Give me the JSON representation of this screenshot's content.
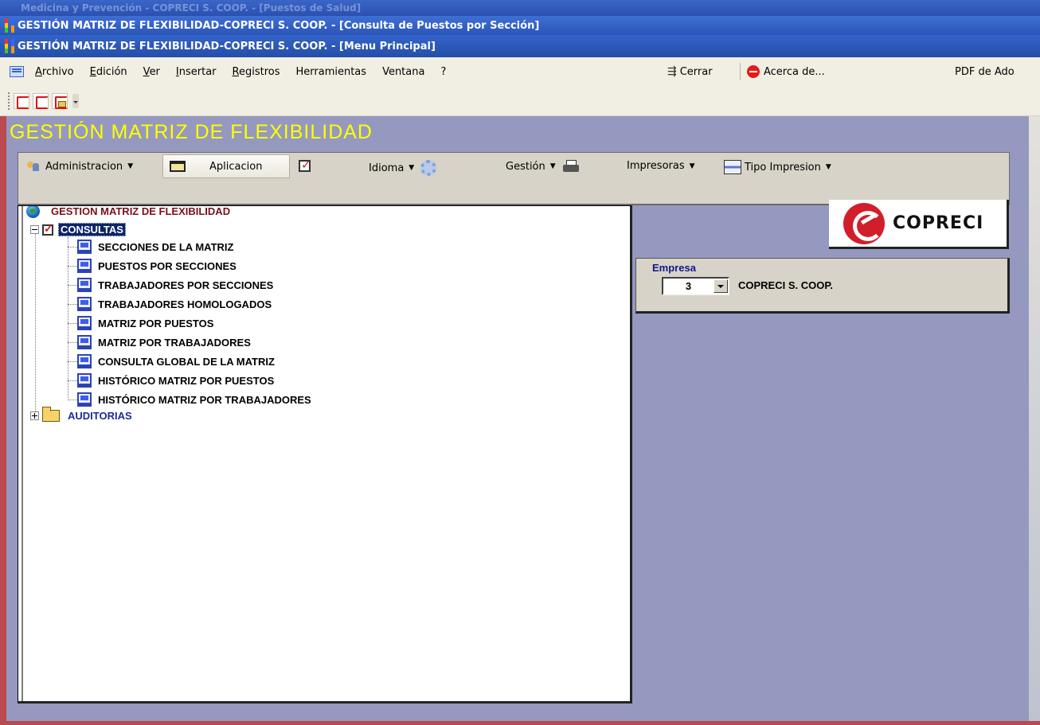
{
  "window": {
    "ghost_title": "Medicina y Prevención - COPRECI S. COOP. - [Puestos de Salud]",
    "title_1": "GESTIÓN MATRIZ DE FLEXIBILIDAD-COPRECI S. COOP. - [Consulta de Puestos por Sección]",
    "title_2": "GESTIÓN MATRIZ DE FLEXIBILIDAD-COPRECI S. COOP. - [Menu Principal]"
  },
  "menubar": {
    "items": [
      "Archivo",
      "Edición",
      "Ver",
      "Insertar",
      "Registros",
      "Herramientas",
      "Ventana",
      "?"
    ],
    "close_label": "Cerrar",
    "about_label": "Acerca de...",
    "pdf_label": "PDF de Ado"
  },
  "toolbar": {
    "icons": [
      "pdf-icon",
      "pdf-icon",
      "pdf-mail-icon"
    ]
  },
  "app": {
    "title": "GESTIÓN MATRIZ DE FLEXIBILIDAD"
  },
  "commands": {
    "admin": "Administracion",
    "aplicacion": "Aplicacion",
    "idioma": "Idioma",
    "gestion": "Gestión",
    "impresoras": "Impresoras",
    "tipo_impresion": "Tipo Impresion"
  },
  "tree": {
    "root": "GESTION MATRIZ DE FLEXIBILIDAD",
    "consultas": "CONSULTAS",
    "items": [
      "SECCIONES DE LA MATRIZ",
      "PUESTOS POR SECCIONES",
      "TRABAJADORES POR SECCIONES",
      "TRABAJADORES HOMOLOGADOS",
      "MATRIZ POR PUESTOS",
      "MATRIZ POR TRABAJADORES",
      "CONSULTA GLOBAL DE LA MATRIZ",
      "HISTÓRICO MATRIZ POR PUESTOS",
      "HISTÓRICO MATRIZ POR TRABAJADORES"
    ],
    "auditorias": "AUDITORIAS"
  },
  "logo": {
    "text": "COPRECI"
  },
  "empresa": {
    "label": "Empresa",
    "code": "3",
    "name": "COPRECI S. COOP."
  }
}
